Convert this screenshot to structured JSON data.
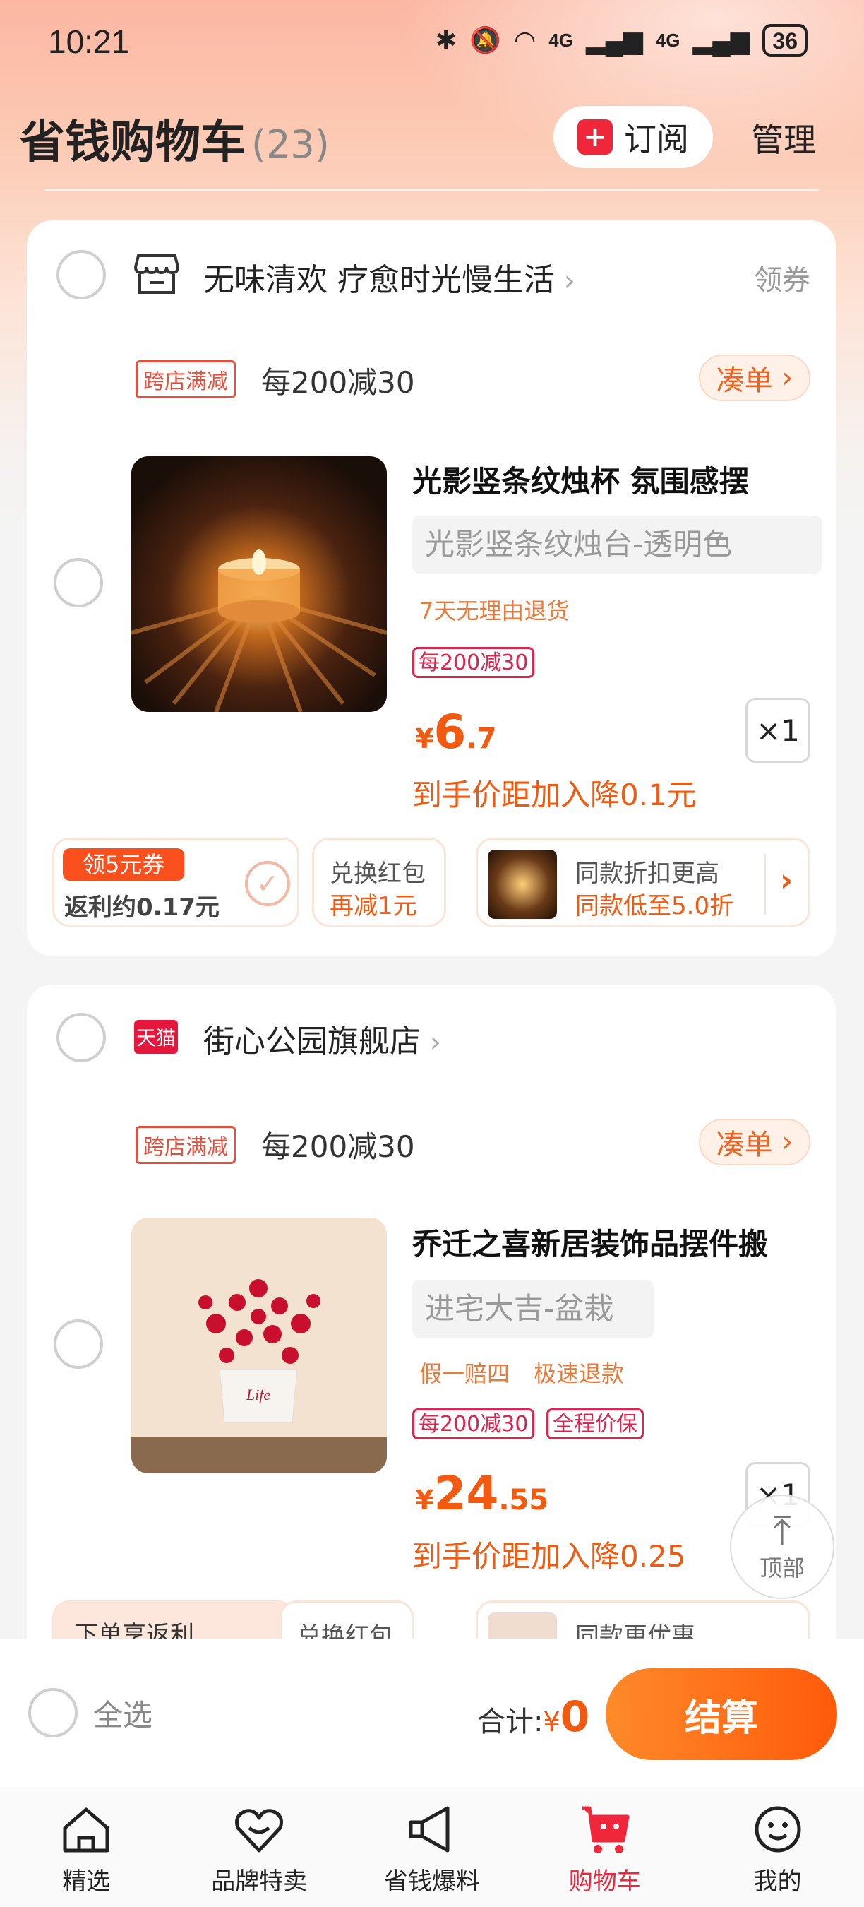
{
  "status_bar": {
    "time": "10:21",
    "network": "4G",
    "battery": "36"
  },
  "header": {
    "title": "省钱购物车",
    "count": "(23)",
    "subscribe_label": "订阅",
    "manage_label": "管理"
  },
  "stores": [
    {
      "name": "无味清欢 疗愈时光慢生活",
      "coupon_label": "领券",
      "promo_tag": "跨店满减",
      "promo_text": "每200减30",
      "bundle_label": "凑单",
      "item": {
        "title": "光影竖条纹烛杯 氛围感摆",
        "sku": "光影竖条纹烛台-透明色",
        "services": [
          "7天无理由退货"
        ],
        "tags": [
          "每200减30"
        ],
        "price_int": "6",
        "price_dec": ".7",
        "price_hint": "到手价距加入降0.1元",
        "quantity": "×1"
      },
      "chips": {
        "coupon_badge": "领5元券",
        "rebate": "返利约0.17元",
        "redpacket_title": "兑换红包",
        "redpacket_sub": "再减1元",
        "similar_title": "同款折扣更高",
        "similar_sub": "同款低至5.0折"
      }
    },
    {
      "name": "街心公园旗舰店",
      "badge": "天猫",
      "promo_tag": "跨店满减",
      "promo_text": "每200减30",
      "bundle_label": "凑单",
      "item": {
        "title": "乔迁之喜新居装饰品摆件搬",
        "sku": "进宅大吉-盆栽",
        "services": [
          "假一赔四",
          "极速退款"
        ],
        "tags": [
          "每200减30",
          "全程价保"
        ],
        "price_int": "24",
        "price_dec": ".55",
        "price_hint": "到手价距加入降0.25",
        "quantity": "×1"
      },
      "chips": {
        "rebate_title": "下单享返利",
        "redpacket_title": "兑换红包",
        "similar_title": "同款更优惠"
      }
    }
  ],
  "to_top_label": "顶部",
  "checkout_bar": {
    "select_all": "全选",
    "total_label": "合计:",
    "currency": "¥",
    "total_value": "0",
    "checkout_label": "结算"
  },
  "tabs": [
    {
      "label": "精选",
      "icon": "home-icon"
    },
    {
      "label": "品牌特卖",
      "icon": "heart-bag-icon"
    },
    {
      "label": "省钱爆料",
      "icon": "megaphone-icon"
    },
    {
      "label": "购物车",
      "icon": "cart-icon",
      "active": true
    },
    {
      "label": "我的",
      "icon": "smiley-icon"
    }
  ],
  "colors": {
    "accent": "#f25a10",
    "brand_red": "#f0263b",
    "tmall_red": "#e6173c"
  }
}
